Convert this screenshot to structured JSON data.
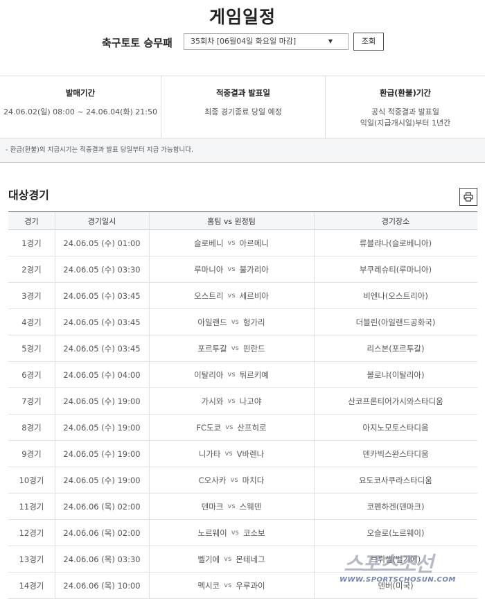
{
  "page": {
    "title": "게임일정"
  },
  "selector": {
    "game_name": "축구토토 승무패",
    "round_value": "35회차 [06월04일 화요일 마감]",
    "search_label": "조회"
  },
  "info": {
    "sale": {
      "heading": "발매기간",
      "value": "24.06.02(일) 08:00 ~ 24.06.04(화) 21:50"
    },
    "result": {
      "heading": "적중결과 발표일",
      "value": "최종 경기종료 당일 예정"
    },
    "refund": {
      "heading": "환급(환불)기간",
      "line1": "공식 적중결과 발표일",
      "line2": "익일(지급개시일)부터 1년간"
    },
    "notice": "- 환급(환불)의 지급시기는 적중결과 발표 당일부터 지급 가능합니다."
  },
  "section": {
    "title": "대상경기",
    "print_icon": "printer-icon"
  },
  "table": {
    "headers": {
      "no": "경기",
      "datetime": "경기일시",
      "teams": "홈팀 vs 원정팀",
      "venue": "경기장소"
    },
    "vs_label": "vs",
    "rows": [
      {
        "no": "1경기",
        "datetime": "24.06.05 (수) 01:00",
        "home": "슬로베니",
        "away": "아르메니",
        "venue": "류블랴나(슬로베니아)"
      },
      {
        "no": "2경기",
        "datetime": "24.06.05 (수) 03:30",
        "home": "루마니아",
        "away": "불가리아",
        "venue": "부쿠레슈티(루마니아)"
      },
      {
        "no": "3경기",
        "datetime": "24.06.05 (수) 03:45",
        "home": "오스트리",
        "away": "세르비아",
        "venue": "비엔나(오스트리아)"
      },
      {
        "no": "4경기",
        "datetime": "24.06.05 (수) 03:45",
        "home": "아일랜드",
        "away": "헝가리",
        "venue": "더블린(아일랜드공화국)"
      },
      {
        "no": "5경기",
        "datetime": "24.06.05 (수) 03:45",
        "home": "포르투갈",
        "away": "핀란드",
        "venue": "리스본(포르투갈)"
      },
      {
        "no": "6경기",
        "datetime": "24.06.05 (수) 04:00",
        "home": "이탈리아",
        "away": "튀르키예",
        "venue": "볼로냐(이탈리아)"
      },
      {
        "no": "7경기",
        "datetime": "24.06.05 (수) 19:00",
        "home": "가시와",
        "away": "나고야",
        "venue": "산코프론티어가시와스타디움"
      },
      {
        "no": "8경기",
        "datetime": "24.06.05 (수) 19:00",
        "home": "FC도쿄",
        "away": "산프히로",
        "venue": "아지노모토스타디움"
      },
      {
        "no": "9경기",
        "datetime": "24.06.05 (수) 19:00",
        "home": "니가타",
        "away": "V바렌나",
        "venue": "덴카빅스완스타디움"
      },
      {
        "no": "10경기",
        "datetime": "24.06.05 (수) 19:00",
        "home": "C오사카",
        "away": "마치다",
        "venue": "요도코사쿠라스타디움"
      },
      {
        "no": "11경기",
        "datetime": "24.06.06 (목) 02:00",
        "home": "덴마크",
        "away": "스웨덴",
        "venue": "코펜하겐(덴마크)"
      },
      {
        "no": "12경기",
        "datetime": "24.06.06 (목) 02:00",
        "home": "노르웨이",
        "away": "코소보",
        "venue": "오슬로(노르웨이)"
      },
      {
        "no": "13경기",
        "datetime": "24.06.06 (목) 03:30",
        "home": "벨기에",
        "away": "몬테네그",
        "venue": "브뤼셀(벨기에)"
      },
      {
        "no": "14경기",
        "datetime": "24.06.06 (목) 10:00",
        "home": "멕시코",
        "away": "우루과이",
        "venue": "덴버(미국)"
      }
    ]
  },
  "watermark": {
    "big": "스포츠조선",
    "small": "WWW.SPORTSCHOSUN.COM"
  }
}
